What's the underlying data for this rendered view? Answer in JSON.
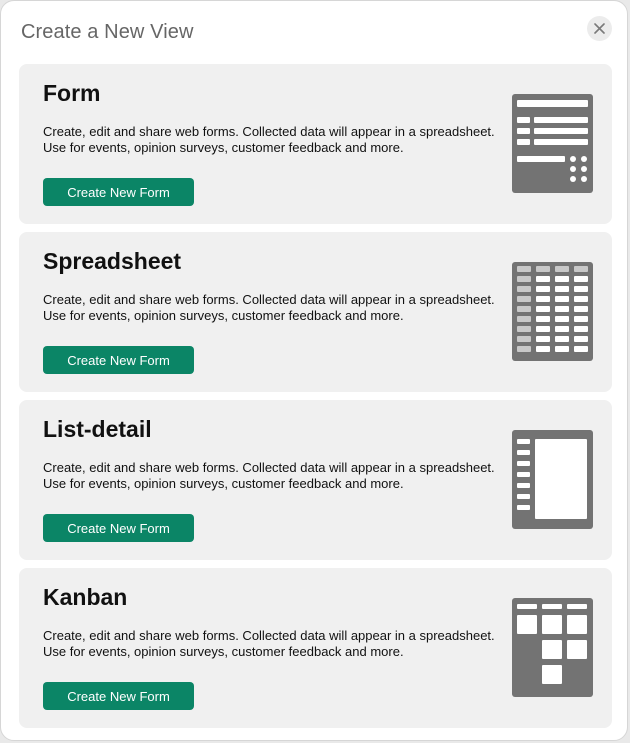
{
  "dialog": {
    "title": "Create a New View",
    "close_glyph": "✕"
  },
  "cards": [
    {
      "title": "Form",
      "desc_line1": "Create, edit and share web forms. Collected data will appear in a spreadsheet.",
      "desc_line2": "Use for events, opinion surveys, customer feedback and more.",
      "button": "Create New Form",
      "icon": "form-icon"
    },
    {
      "title": "Spreadsheet",
      "desc_line1": "Create, edit and share web forms. Collected data will appear in a spreadsheet.",
      "desc_line2": "Use for events, opinion surveys, customer feedback and more.",
      "button": "Create New Form",
      "icon": "spreadsheet-icon"
    },
    {
      "title": "List-detail",
      "desc_line1": "Create, edit and share web forms. Collected data will appear in a spreadsheet.",
      "desc_line2": "Use for events, opinion surveys, customer feedback and more.",
      "button": "Create New Form",
      "icon": "list-detail-icon"
    },
    {
      "title": "Kanban",
      "desc_line1": "Create, edit and share web forms. Collected data will appear in a spreadsheet.",
      "desc_line2": "Use for events, opinion surveys, customer feedback and more.",
      "button": "Create New Form",
      "icon": "kanban-icon"
    }
  ],
  "colors": {
    "button_bg": "#0b8566",
    "icon_gray": "#737373",
    "card_bg": "#f0f0f0"
  }
}
